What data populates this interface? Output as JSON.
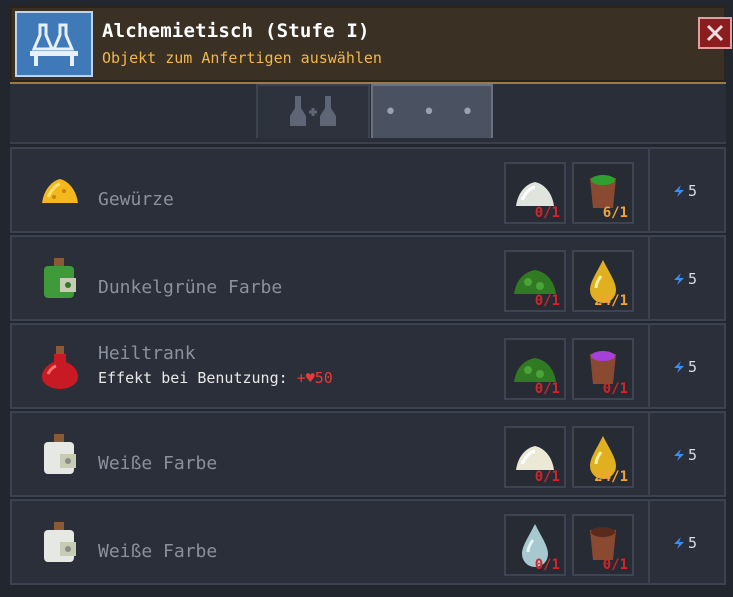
{
  "header": {
    "title": "Alchemietisch (Stufe I)",
    "subtitle": "Objekt zum Anfertigen auswählen",
    "icon": "alchemy-table-icon",
    "close_icon": "close-icon"
  },
  "tabs": [
    {
      "icon": "flasks-icon",
      "active": false
    },
    {
      "label": "• • •",
      "active": true
    }
  ],
  "recipes": [
    {
      "name": "Gewürze",
      "icon": "spice-pile-icon",
      "ingredients": [
        {
          "icon": "salt-pile-icon",
          "count": "0/1",
          "status": "missing"
        },
        {
          "icon": "green-pot-icon",
          "count": "6/1",
          "status": "ok"
        }
      ],
      "energy": "5"
    },
    {
      "name": "Dunkelgrüne Farbe",
      "icon": "green-dye-bottle-icon",
      "ingredients": [
        {
          "icon": "green-leaves-icon",
          "count": "0/1",
          "status": "missing"
        },
        {
          "icon": "oil-drop-icon",
          "count": "24/1",
          "status": "ok"
        }
      ],
      "energy": "5"
    },
    {
      "name": "Heiltrank",
      "icon": "healing-potion-icon",
      "effect_label": "Effekt bei Benutzung:",
      "effect_value": "+♥50",
      "ingredients": [
        {
          "icon": "green-leaves-icon",
          "count": "0/1",
          "status": "missing"
        },
        {
          "icon": "purple-pot-icon",
          "count": "0/1",
          "status": "missing"
        }
      ],
      "energy": "5"
    },
    {
      "name": "Weiße Farbe",
      "icon": "white-dye-bottle-icon",
      "ingredients": [
        {
          "icon": "white-powder-icon",
          "count": "0/1",
          "status": "missing"
        },
        {
          "icon": "oil-drop-icon",
          "count": "24/1",
          "status": "ok"
        }
      ],
      "energy": "5"
    },
    {
      "name": "Weiße Farbe",
      "icon": "white-dye-bottle-icon",
      "ingredients": [
        {
          "icon": "water-drop-icon",
          "count": "0/1",
          "status": "missing"
        },
        {
          "icon": "brown-pot-icon",
          "count": "0/1",
          "status": "missing"
        }
      ],
      "energy": "5"
    }
  ],
  "colors": {
    "title_bar": "#3a3024",
    "subtitle": "#f2b84a",
    "missing": "#d4232a",
    "available": "#f0a43a",
    "energy_bolt": "#3a8cf0"
  }
}
